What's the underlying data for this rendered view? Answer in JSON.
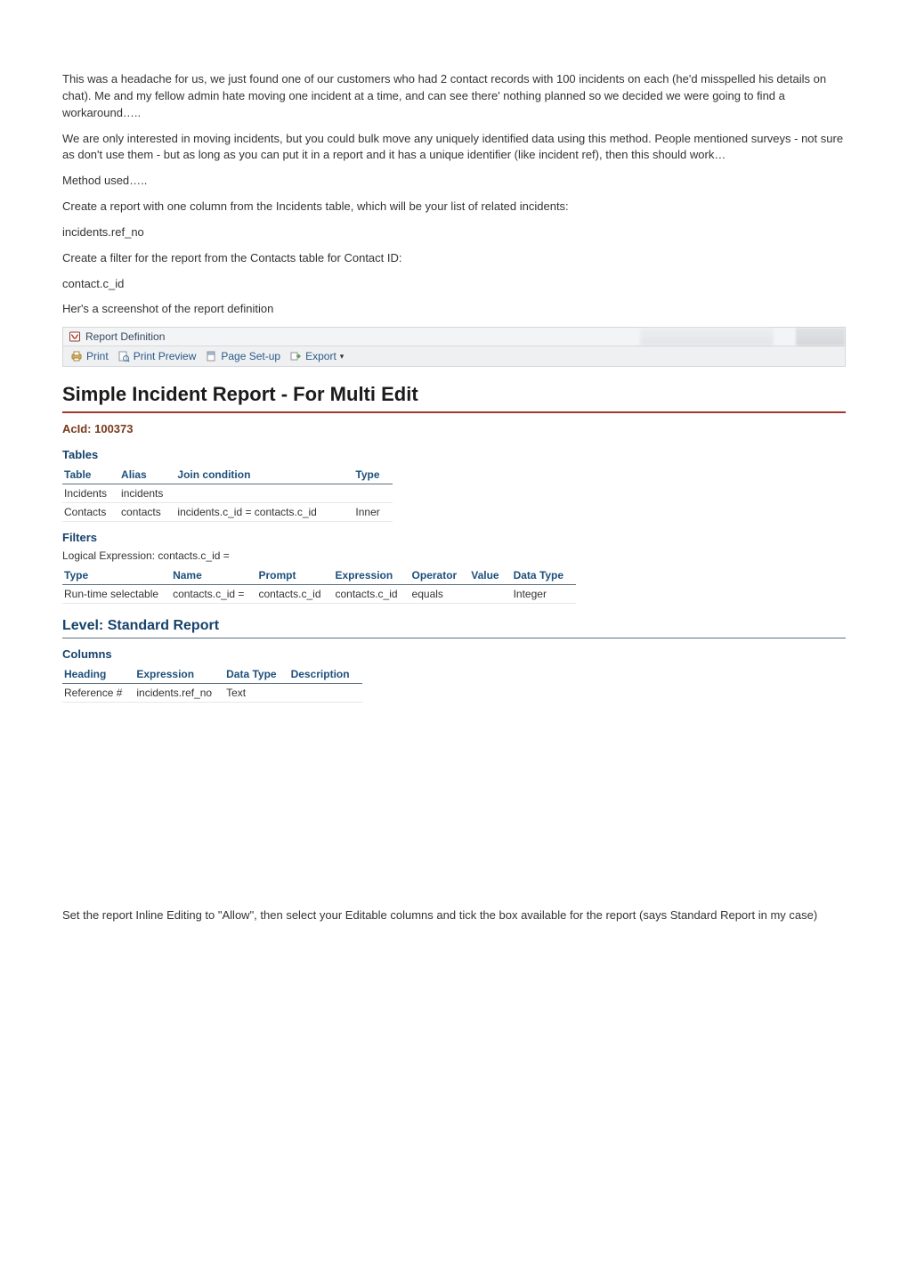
{
  "paragraphs": {
    "p1": "This was a headache for us, we just found one of our customers who had 2 contact records with 100 incidents on each (he'd misspelled his details on chat). Me and my fellow admin hate moving one incident at a time, and can see there' nothing planned so we decided we were going to find a workaround…..",
    "p2": "We are only interested in moving incidents, but you could bulk move any uniquely identified data using this method. People mentioned surveys - not sure as don't use them - but as long as you can put it in a report and it has a unique identifier (like incident ref), then this should work…",
    "p3": "Method used…..",
    "p4": "Create a report with one column from the Incidents table, which will be your list of related incidents:",
    "p5": "incidents.ref_no",
    "p6": "Create a filter for the report from the Contacts table for Contact ID:",
    "p7": "contact.c_id",
    "p8": "Her's a screenshot of the report definition",
    "p9": "Set the report Inline Editing to \"Allow\", then select your Editable columns and tick the box available for the report (says Standard Report in my case)"
  },
  "window": {
    "title": "Report Definition"
  },
  "toolbar": {
    "print": "Print",
    "print_preview": "Print Preview",
    "page_setup": "Page Set-up",
    "export": "Export"
  },
  "report": {
    "title": "Simple Incident Report - For Multi Edit",
    "acid_label": "AcId: 100373"
  },
  "sections": {
    "tables_h": "Tables",
    "filters_h": "Filters",
    "columns_h": "Columns",
    "level_h": "Level: Standard Report"
  },
  "tables": {
    "headers": {
      "table": "Table",
      "alias": "Alias",
      "join": "Join condition",
      "type": "Type"
    },
    "rows": [
      {
        "table": "Incidents",
        "alias": "incidents",
        "join": "",
        "type": ""
      },
      {
        "table": "Contacts",
        "alias": "contacts",
        "join": "incidents.c_id = contacts.c_id",
        "type": "Inner"
      }
    ]
  },
  "filters": {
    "logical_expression_label": "Logical Expression:  contacts.c_id =",
    "headers": {
      "type": "Type",
      "name": "Name",
      "prompt": "Prompt",
      "expression": "Expression",
      "operator": "Operator",
      "value": "Value",
      "data_type": "Data Type"
    },
    "rows": [
      {
        "type": "Run-time selectable",
        "name": "contacts.c_id =",
        "prompt": "contacts.c_id",
        "expression": "contacts.c_id",
        "operator": "equals",
        "value": "",
        "data_type": "Integer"
      }
    ]
  },
  "columns": {
    "headers": {
      "heading": "Heading",
      "expression": "Expression",
      "data_type": "Data Type",
      "description": "Description"
    },
    "rows": [
      {
        "heading": "Reference #",
        "expression": "incidents.ref_no",
        "data_type": "Text",
        "description": ""
      }
    ]
  }
}
